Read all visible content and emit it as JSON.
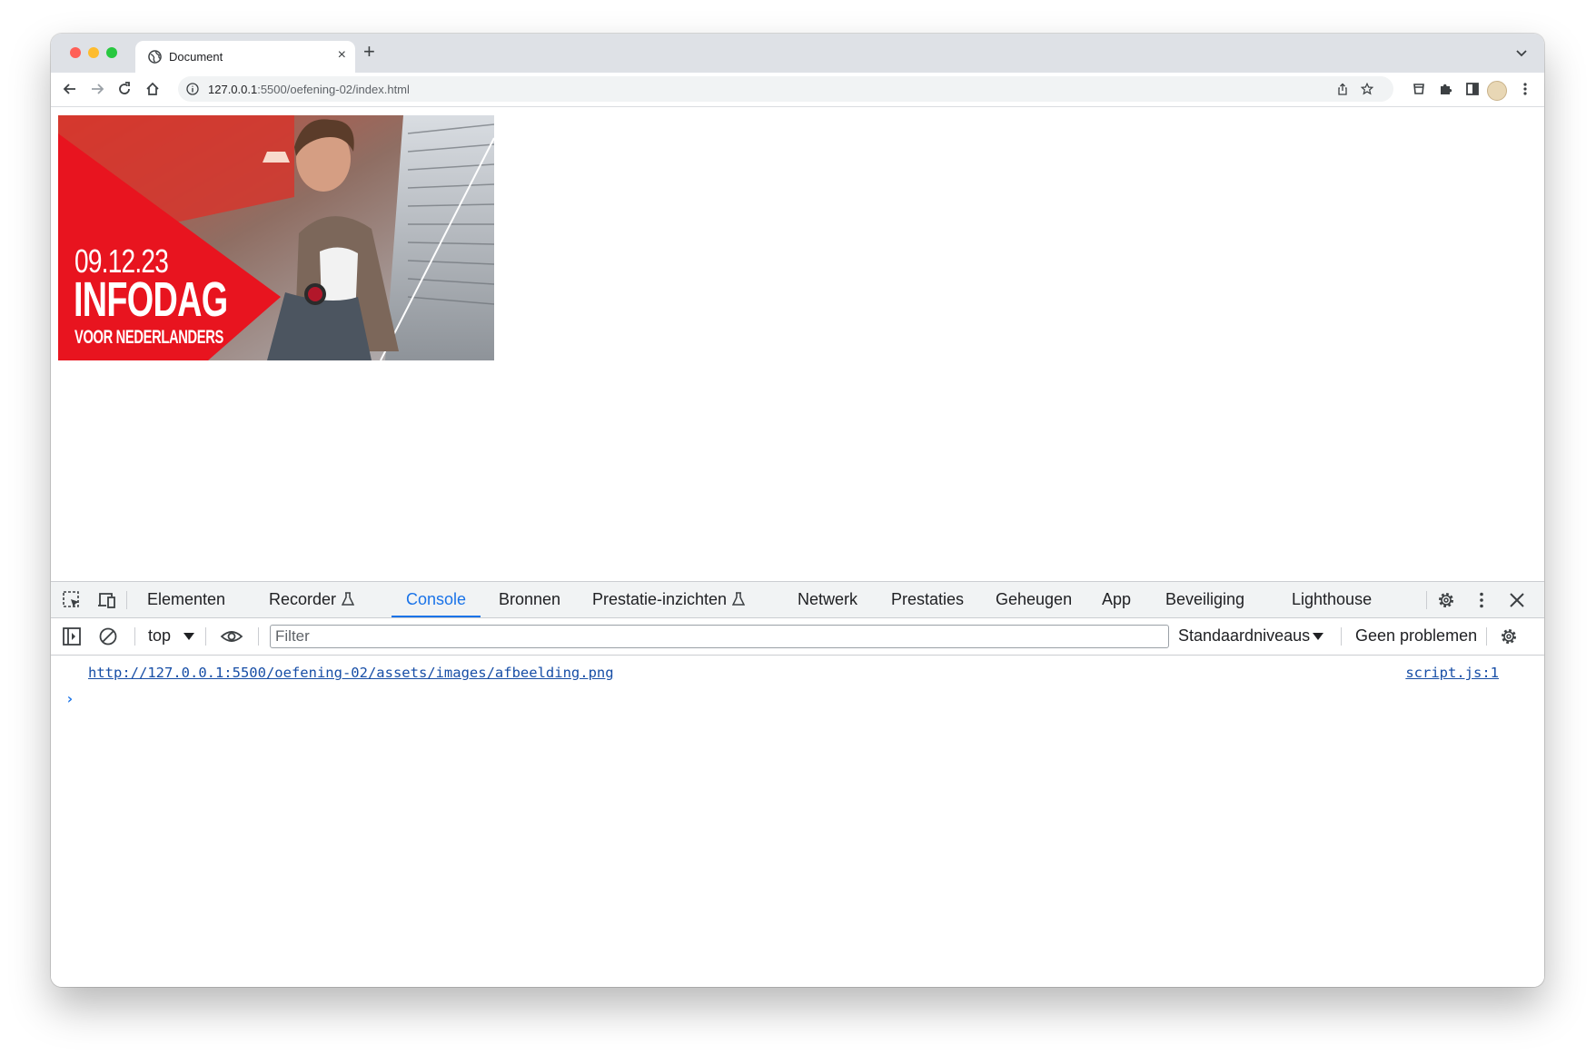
{
  "browser": {
    "tab_title": "Document",
    "url_host": "127.0.0.1",
    "url_rest": ":5500/oefening-02/index.html"
  },
  "page": {
    "banner": {
      "date": "09.12.23",
      "headline": "INFODAG",
      "subline": "VOOR NEDERLANDERS",
      "accent_color": "#e8141f"
    }
  },
  "devtools": {
    "tabs": [
      {
        "label": "Elementen"
      },
      {
        "label": "Recorder",
        "icon": "flask-icon"
      },
      {
        "label": "Console",
        "active": true
      },
      {
        "label": "Bronnen"
      },
      {
        "label": "Prestatie-inzichten",
        "icon": "flask-icon"
      },
      {
        "label": "Netwerk"
      },
      {
        "label": "Prestaties"
      },
      {
        "label": "Geheugen"
      },
      {
        "label": "App"
      },
      {
        "label": "Beveiliging"
      },
      {
        "label": "Lighthouse"
      }
    ],
    "console_toolbar": {
      "context": "top",
      "filter_placeholder": "Filter",
      "levels": "Standaardniveaus",
      "issues": "Geen problemen"
    },
    "console": {
      "messages": [
        {
          "text": "http://127.0.0.1:5500/oefening-02/assets/images/afbeelding.png",
          "source": "script.js:1"
        }
      ],
      "prompt": "›"
    },
    "accent_color": "#1a73e8"
  }
}
